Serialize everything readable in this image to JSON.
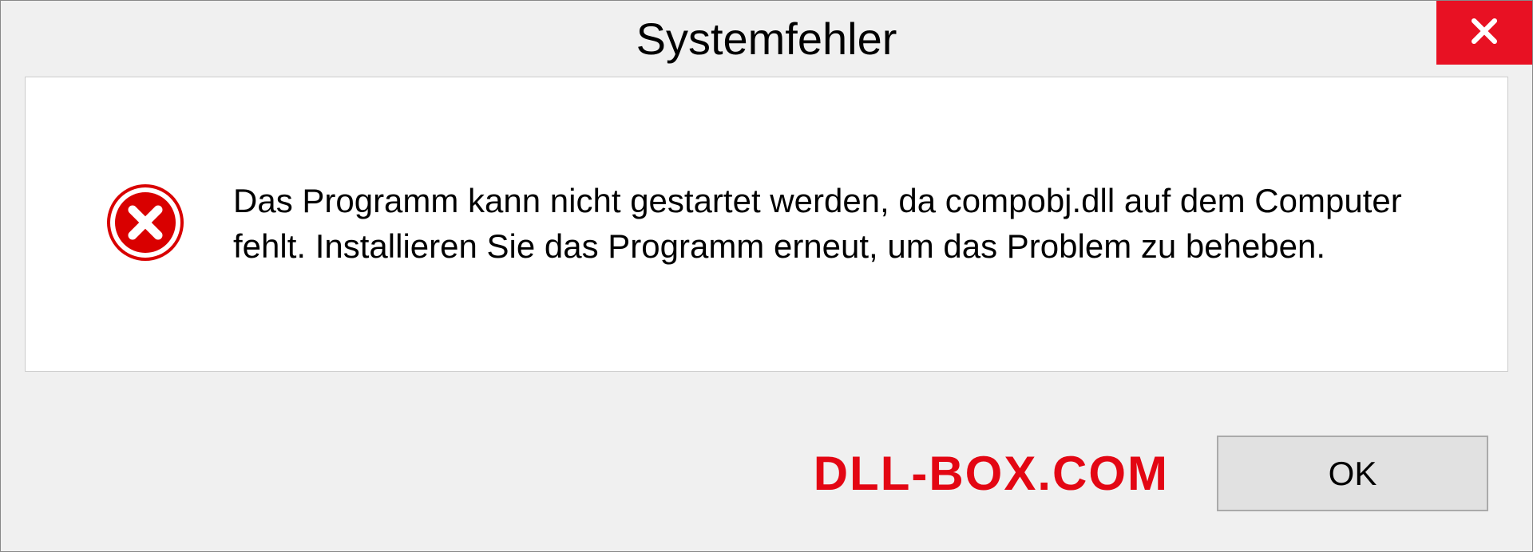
{
  "dialog": {
    "title": "Systemfehler",
    "message": "Das Programm kann nicht gestartet werden, da compobj.dll auf dem Computer fehlt. Installieren Sie das Programm erneut, um das Problem zu beheben.",
    "ok_label": "OK",
    "watermark": "DLL-BOX.COM"
  }
}
